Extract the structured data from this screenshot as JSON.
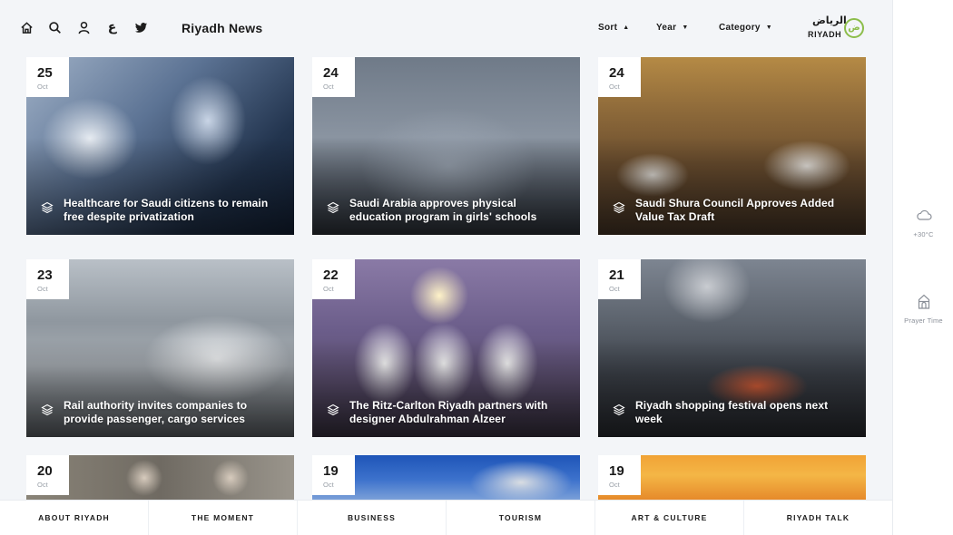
{
  "header": {
    "title": "Riyadh News",
    "arabic_toggle": "ع",
    "filters": [
      {
        "label": "Sort",
        "caret": "▲"
      },
      {
        "label": "Year",
        "caret": "▼"
      },
      {
        "label": "Category",
        "caret": "▼"
      }
    ],
    "logo": {
      "arabic": "الرياض",
      "english": "RIYADH",
      "mark": "ض"
    }
  },
  "sidebar": {
    "weather": {
      "icon": "cloud-icon",
      "label": "+30°C"
    },
    "prayer": {
      "icon": "mosque-icon",
      "label": "Prayer Time"
    }
  },
  "cards": [
    {
      "day": "25",
      "month": "Oct",
      "caption": "Healthcare for Saudi citizens to remain free despite privatization",
      "icon": "layers-icon"
    },
    {
      "day": "24",
      "month": "Oct",
      "caption": "Saudi Arabia approves physical education program in girls' schools",
      "icon": "layers-icon"
    },
    {
      "day": "24",
      "month": "Oct",
      "caption": "Saudi Shura Council Approves Added Value Tax Draft",
      "icon": "layers-icon"
    },
    {
      "day": "23",
      "month": "Oct",
      "caption": "Rail authority invites companies to provide passenger, cargo services",
      "icon": "layers-icon"
    },
    {
      "day": "22",
      "month": "Oct",
      "caption": "The Ritz-Carlton Riyadh partners with designer Abdulrahman Alzeer",
      "icon": "layers-icon"
    },
    {
      "day": "21",
      "month": "Oct",
      "caption": "Riyadh shopping festival opens next week",
      "icon": "layers-icon"
    },
    {
      "day": "20",
      "month": "Oct",
      "caption": "",
      "icon": ""
    },
    {
      "day": "19",
      "month": "Oct",
      "caption": "",
      "icon": ""
    },
    {
      "day": "19",
      "month": "Oct",
      "caption": "",
      "icon": ""
    }
  ],
  "bottom_nav": [
    "ABOUT RIYADH",
    "THE MOMENT",
    "BUSINESS",
    "TOURISM",
    "ART & CULTURE",
    "RIYADH TALK"
  ],
  "colors": {
    "accent": "#8cbd4a",
    "background": "#f3f5f8"
  }
}
